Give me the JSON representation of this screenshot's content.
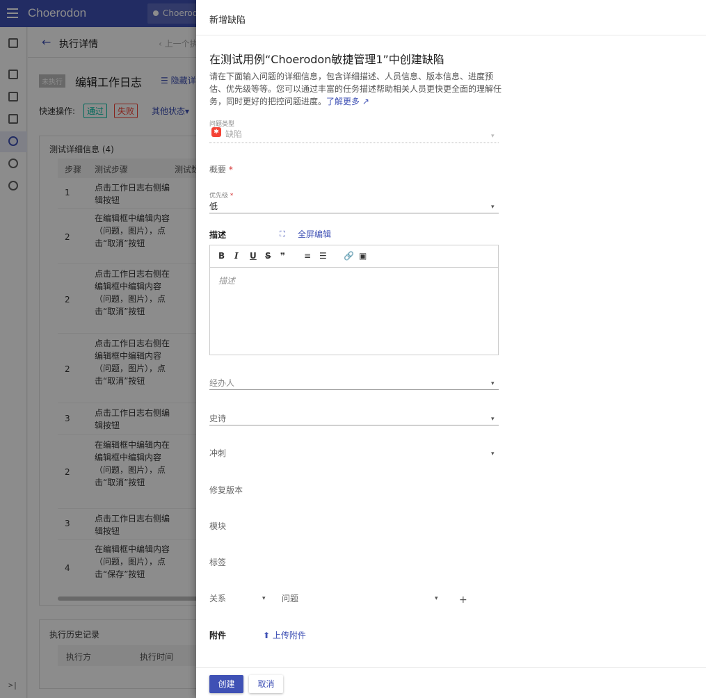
{
  "app": {
    "logo": "Choerodon",
    "project": "Choerodon"
  },
  "header": {
    "title": "执行详情",
    "prev": "上一个执"
  },
  "execution": {
    "status": "未执行",
    "title": "编辑工作日志",
    "hide_link": "隐藏详"
  },
  "quick_ops": {
    "label": "快速操作:",
    "pass": "通过",
    "fail": "失败",
    "other": "其他状态"
  },
  "test_detail": {
    "title": "测试详细信息 (4)",
    "columns": [
      "步骤",
      "测试步骤",
      "测试数"
    ],
    "rows": [
      {
        "n": "1",
        "s": "点击工作日志右侧编辑按钮"
      },
      {
        "n": "2",
        "s": "在编辑框中编辑内容（问题，图片），点击“取消”按钮"
      },
      {
        "n": "2",
        "s": "点击工作日志右侧在编辑框中编辑内容（问题，图片），点击“取消”按钮"
      },
      {
        "n": "2",
        "s": "点击工作日志右侧在编辑框中编辑内容（问题，图片），点击“取消”按钮"
      },
      {
        "n": "3",
        "s": "点击工作日志右侧编辑按钮"
      },
      {
        "n": "2",
        "s": "在编辑框中编辑内在编辑框中编辑内容（问题，图片），点击“取消”按钮"
      },
      {
        "n": "3",
        "s": "点击工作日志右侧编辑按钮"
      },
      {
        "n": "4",
        "s": "在编辑框中编辑内容（问题，图片），点击“保存”按钮"
      }
    ]
  },
  "history": {
    "title": "执行历史记录",
    "columns": [
      "执行方",
      "执行时间"
    ]
  },
  "drawer": {
    "header": "新增缺陷",
    "title": "在测试用例“Choerodon敏捷管理1”中创建缺陷",
    "description": "请在下面输入问题的详细信息，包含详细描述、人员信息、版本信息、进度预估、优先级等等。您可以通过丰富的任务描述帮助相关人员更快更全面的理解任务，同时更好的把控问题进度。",
    "learn_more": "了解更多",
    "issue_type_label": "问题类型",
    "issue_type_value": "缺陷",
    "summary_label": "概要",
    "priority_label": "优先级",
    "priority_value": "低",
    "desc_label": "描述",
    "full_edit": "全屏编辑",
    "desc_placeholder": "描述",
    "assignee": "经办人",
    "epic": "史诗",
    "sprint": "冲刺",
    "fix_version": "修复版本",
    "module": "模块",
    "label": "标签",
    "relation": "关系",
    "issue": "问题",
    "attachment": "附件",
    "upload": "上传附件",
    "create": "创建",
    "cancel": "取消"
  }
}
